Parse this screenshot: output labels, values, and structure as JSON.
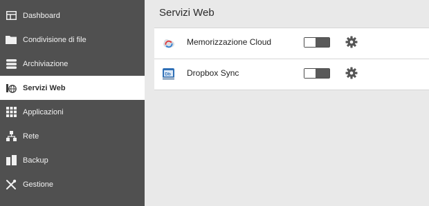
{
  "sidebar": {
    "items": [
      {
        "label": "Dashboard",
        "icon": "dashboard-icon",
        "active": false
      },
      {
        "label": "Condivisione di file",
        "icon": "folder-icon",
        "active": false
      },
      {
        "label": "Archiviazione",
        "icon": "storage-icon",
        "active": false
      },
      {
        "label": "Servizi Web",
        "icon": "globe-icon",
        "active": true
      },
      {
        "label": "Applicazioni",
        "icon": "apps-grid-icon",
        "active": false
      },
      {
        "label": "Rete",
        "icon": "network-icon",
        "active": false
      },
      {
        "label": "Backup",
        "icon": "backup-icon",
        "active": false
      },
      {
        "label": "Gestione",
        "icon": "tools-icon",
        "active": false
      }
    ]
  },
  "main": {
    "title": "Servizi Web",
    "services": [
      {
        "name": "Memorizzazione Cloud",
        "icon": "cloud-sync-icon",
        "enabled": false
      },
      {
        "name": "Dropbox Sync",
        "icon": "dropbox-icon",
        "enabled": false
      }
    ]
  },
  "colors": {
    "sidebar_bg": "#505050",
    "content_bg": "#e9e9e9",
    "active_item_bg": "#ffffff"
  }
}
